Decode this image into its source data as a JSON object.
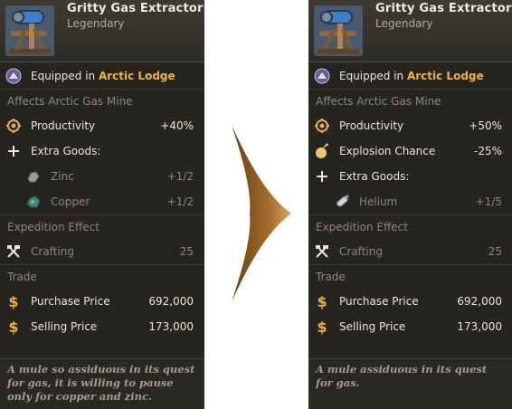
{
  "colors": {
    "panel": "#26241f",
    "location": "#f0b43c",
    "arrow": "#b07a2a"
  },
  "before": {
    "title": "Gritty Gas Extractor",
    "rarity": "Legendary",
    "equipped_prefix": "Equipped in",
    "equipped_location": "Arctic Lodge",
    "affects": "Affects Arctic Gas Mine",
    "productivity": {
      "label": "Productivity",
      "value": "+40%"
    },
    "extra_goods_label": "Extra Goods:",
    "extra_goods": [
      {
        "label": "Zinc",
        "value": "+1/2",
        "icon": "zinc-ore-icon"
      },
      {
        "label": "Copper",
        "value": "+1/2",
        "icon": "copper-ore-icon"
      }
    ],
    "expedition_label": "Expedition Effect",
    "crafting": {
      "label": "Crafting",
      "value": "25"
    },
    "trade_label": "Trade",
    "purchase": {
      "label": "Purchase Price",
      "value": "692,000"
    },
    "selling": {
      "label": "Selling Price",
      "value": "173,000"
    },
    "flavor": "A mule so assiduous in its quest for gas, it is willing to pause only for copper and zinc."
  },
  "after": {
    "title": "Gritty Gas Extractor",
    "rarity": "Legendary",
    "equipped_prefix": "Equipped in",
    "equipped_location": "Arctic Lodge",
    "affects": "Affects Arctic Gas Mine",
    "productivity": {
      "label": "Productivity",
      "value": "+50%"
    },
    "explosion": {
      "label": "Explosion Chance",
      "value": "-25%"
    },
    "extra_goods_label": "Extra Goods:",
    "extra_goods": [
      {
        "label": "Helium",
        "value": "+1/5",
        "icon": "helium-canister-icon"
      }
    ],
    "expedition_label": "Expedition Effect",
    "crafting": {
      "label": "Crafting",
      "value": "25"
    },
    "trade_label": "Trade",
    "purchase": {
      "label": "Purchase Price",
      "value": "692,000"
    },
    "selling": {
      "label": "Selling Price",
      "value": "173,000"
    },
    "flavor": "A mule assiduous in its quest for gas."
  }
}
